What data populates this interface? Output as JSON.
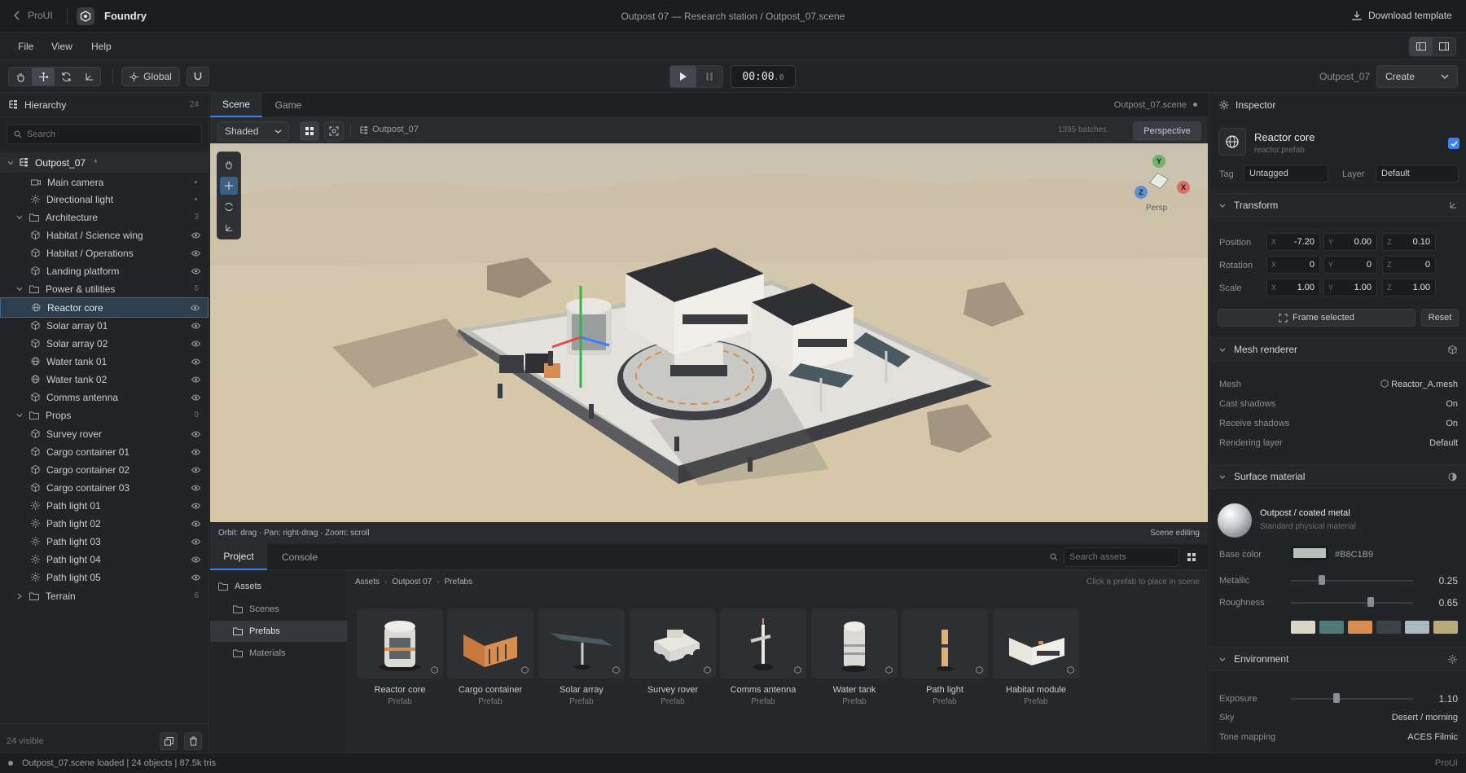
{
  "titlebar": {
    "back_label": "ProUI",
    "app_name": "Foundry",
    "doc_title": "Outpost 07 — Research station / Outpost_07.scene",
    "download_label": "Download template"
  },
  "menu": {
    "items": [
      "File",
      "View",
      "Help"
    ]
  },
  "toolbar": {
    "space_label": "Global",
    "time": "00:00",
    "time_frac": ".0",
    "scene_name": "Outpost_07",
    "create_label": "Create"
  },
  "hierarchy": {
    "title": "Hierarchy",
    "count": "24",
    "search_placeholder": "Search",
    "root": {
      "label": "Outpost_07",
      "marker": "*"
    },
    "items": [
      {
        "label": "Main camera",
        "icon": "camera-icon",
        "level": 1,
        "trail": "dot"
      },
      {
        "label": "Directional light",
        "icon": "sun-icon",
        "level": 1,
        "trail": "dot"
      },
      {
        "label": "Architecture",
        "icon": "folder-icon",
        "level": 0,
        "trail": "3"
      },
      {
        "label": "Habitat / Science wing",
        "icon": "cube-icon",
        "level": 1,
        "trail": "eye"
      },
      {
        "label": "Habitat / Operations",
        "icon": "cube-icon",
        "level": 1,
        "trail": "eye"
      },
      {
        "label": "Landing platform",
        "icon": "cube-icon",
        "level": 1,
        "trail": "eye"
      },
      {
        "label": "Power & utilities",
        "icon": "folder-icon",
        "level": 0,
        "trail": "6"
      },
      {
        "label": "Reactor core",
        "icon": "globe-icon",
        "level": 1,
        "trail": "eye",
        "selected": true
      },
      {
        "label": "Solar array 01",
        "icon": "cube-icon",
        "level": 1,
        "trail": "eye"
      },
      {
        "label": "Solar array 02",
        "icon": "cube-icon",
        "level": 1,
        "trail": "eye"
      },
      {
        "label": "Water tank 01",
        "icon": "globe-icon",
        "level": 1,
        "trail": "eye"
      },
      {
        "label": "Water tank 02",
        "icon": "globe-icon",
        "level": 1,
        "trail": "eye"
      },
      {
        "label": "Comms antenna",
        "icon": "cube-icon",
        "level": 1,
        "trail": "eye"
      },
      {
        "label": "Props",
        "icon": "folder-icon",
        "level": 0,
        "trail": "9"
      },
      {
        "label": "Survey rover",
        "icon": "cube-icon",
        "level": 1,
        "trail": "eye"
      },
      {
        "label": "Cargo container 01",
        "icon": "cube-icon",
        "level": 1,
        "trail": "eye"
      },
      {
        "label": "Cargo container 02",
        "icon": "cube-icon",
        "level": 1,
        "trail": "eye"
      },
      {
        "label": "Cargo container 03",
        "icon": "cube-icon",
        "level": 1,
        "trail": "eye"
      },
      {
        "label": "Path light 01",
        "icon": "sun-icon",
        "level": 1,
        "trail": "eye"
      },
      {
        "label": "Path light 02",
        "icon": "sun-icon",
        "level": 1,
        "trail": "eye"
      },
      {
        "label": "Path light 03",
        "icon": "sun-icon",
        "level": 1,
        "trail": "eye"
      },
      {
        "label": "Path light 04",
        "icon": "sun-icon",
        "level": 1,
        "trail": "eye"
      },
      {
        "label": "Path light 05",
        "icon": "sun-icon",
        "level": 1,
        "trail": "eye"
      },
      {
        "label": "Terrain",
        "icon": "folder-icon",
        "level": 0,
        "trail": "6",
        "collapsed": true
      }
    ],
    "footer": "24 visible"
  },
  "scene": {
    "tabs": [
      "Scene",
      "Game"
    ],
    "file_label": "Outpost_07.scene",
    "shading": "Shaded",
    "breadcrumb": "Outpost_07",
    "batches": "1395 batches",
    "projection": "Perspective",
    "gizmo": {
      "y": "Y",
      "x": "X",
      "z": "Z",
      "label": "Persp"
    },
    "hint": "Orbit: drag · Pan: right-drag · Zoom: scroll",
    "mode": "Scene editing"
  },
  "project": {
    "tabs": [
      "Project",
      "Console"
    ],
    "search_placeholder": "Search assets",
    "tree": [
      "Assets",
      "Scenes",
      "Prefabs",
      "Materials"
    ],
    "breadcrumb": [
      "Assets",
      "Outpost 07",
      "Prefabs"
    ],
    "hint": "Click a prefab to place in scene",
    "assets": [
      {
        "name": "Reactor core",
        "type": "Prefab"
      },
      {
        "name": "Cargo container",
        "type": "Prefab"
      },
      {
        "name": "Solar array",
        "type": "Prefab"
      },
      {
        "name": "Survey rover",
        "type": "Prefab"
      },
      {
        "name": "Comms antenna",
        "type": "Prefab"
      },
      {
        "name": "Water tank",
        "type": "Prefab"
      },
      {
        "name": "Path light",
        "type": "Prefab"
      },
      {
        "name": "Habitat module",
        "type": "Prefab"
      }
    ]
  },
  "inspector": {
    "title": "Inspector",
    "object_name": "Reactor core",
    "object_file": "reactor.prefab",
    "tag_label": "Tag",
    "tag_value": "Untagged",
    "layer_label": "Layer",
    "layer_value": "Default",
    "transform": {
      "title": "Transform",
      "rows": [
        {
          "label": "Position",
          "x": "-7.20",
          "y": "0.00",
          "z": "0.10"
        },
        {
          "label": "Rotation",
          "x": "0",
          "y": "0",
          "z": "0"
        },
        {
          "label": "Scale",
          "x": "1.00",
          "y": "1.00",
          "z": "1.00"
        }
      ],
      "frame_label": "Frame selected",
      "reset_label": "Reset"
    },
    "mesh": {
      "title": "Mesh renderer",
      "rows": [
        {
          "label": "Mesh",
          "value": "Reactor_A.mesh"
        },
        {
          "label": "Cast shadows",
          "value": "On"
        },
        {
          "label": "Receive shadows",
          "value": "On"
        },
        {
          "label": "Rendering layer",
          "value": "Default"
        }
      ]
    },
    "material": {
      "title": "Surface material",
      "name": "Outpost / coated metal",
      "desc": "Standard physical material",
      "base_color_label": "Base color",
      "base_color": "#B8C1B9",
      "metallic_label": "Metallic",
      "metallic": "0.25",
      "roughness_label": "Roughness",
      "roughness": "0.65",
      "swatches": [
        "#d8d6c8",
        "#4f7a78",
        "#d98c4f",
        "#3a4347",
        "#a9b9bf",
        "#b8aa7a"
      ]
    },
    "environment": {
      "title": "Environment",
      "exposure_label": "Exposure",
      "exposure": "1.10",
      "sky_label": "Sky",
      "sky": "Desert / morning",
      "tone_label": "Tone mapping",
      "tone": "ACES Filmic"
    }
  },
  "status": {
    "text": "Outpost_07.scene loaded | 24 objects | 87.5k tris",
    "brand": "ProUI"
  },
  "colors": {
    "accent": "#3b82f6",
    "selection": "#2d3e4d",
    "sand": "#d9ccb4"
  }
}
